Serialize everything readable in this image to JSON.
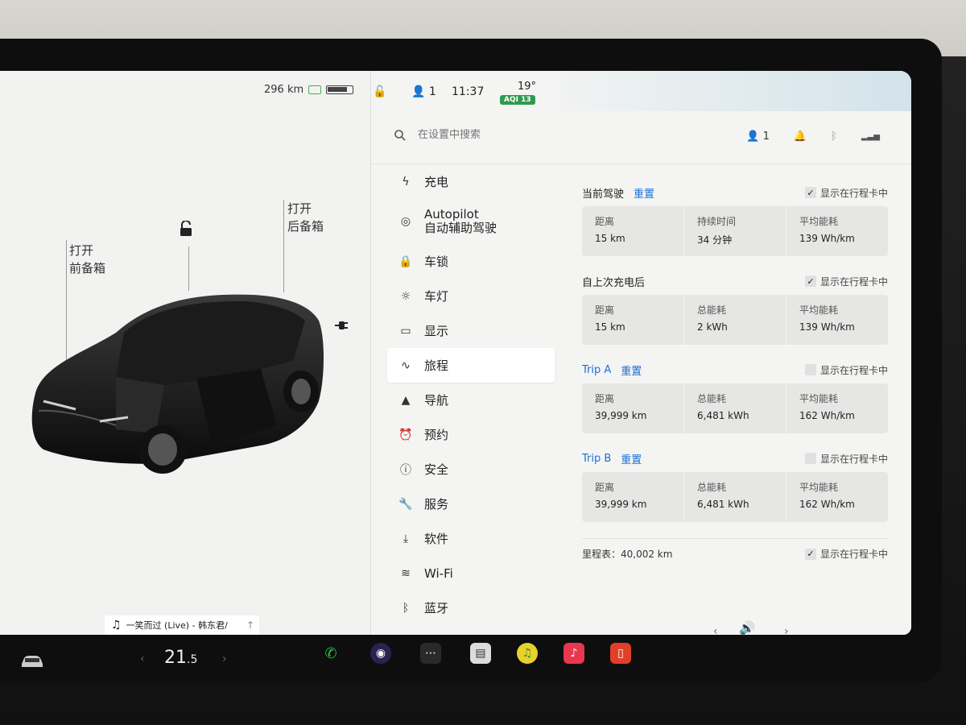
{
  "status": {
    "range": "296 km",
    "passengers": "1",
    "time": "11:37",
    "temperature": "19°",
    "aqi": "AQI 13"
  },
  "car_panel": {
    "frunk_label_line1": "打开",
    "frunk_label_line2": "前备箱",
    "trunk_label_line1": "打开",
    "trunk_label_line2": "后备箱"
  },
  "search": {
    "placeholder": "在设置中搜索",
    "profile_count": "1"
  },
  "nav": {
    "items": [
      {
        "label": "充电",
        "icon": "bolt-icon",
        "glyph": "ϟ"
      },
      {
        "label": "Autopilot",
        "label2": "自动辅助驾驶",
        "icon": "steering-wheel-icon",
        "glyph": "◎"
      },
      {
        "label": "车锁",
        "icon": "lock-icon",
        "glyph": "🔒"
      },
      {
        "label": "车灯",
        "icon": "light-icon",
        "glyph": "☼"
      },
      {
        "label": "显示",
        "icon": "display-icon",
        "glyph": "▭"
      },
      {
        "label": "旅程",
        "icon": "trip-icon",
        "glyph": "∿"
      },
      {
        "label": "导航",
        "icon": "navigation-icon",
        "glyph": "▲"
      },
      {
        "label": "预约",
        "icon": "alarm-icon",
        "glyph": "⏰"
      },
      {
        "label": "安全",
        "icon": "info-icon",
        "glyph": "ⓘ"
      },
      {
        "label": "服务",
        "icon": "wrench-icon",
        "glyph": "🔧"
      },
      {
        "label": "软件",
        "icon": "download-icon",
        "glyph": "⤓"
      },
      {
        "label": "Wi-Fi",
        "icon": "wifi-icon",
        "glyph": "≋"
      },
      {
        "label": "蓝牙",
        "icon": "bluetooth-icon",
        "glyph": "ᛒ"
      }
    ],
    "active_index": 5
  },
  "trips": {
    "current": {
      "title": "当前驾驶",
      "reset": "重置",
      "show_label": "显示在行程卡中",
      "checked": true,
      "stats": [
        {
          "label": "距离",
          "value": "15 km"
        },
        {
          "label": "持续时间",
          "value": "34 分钟"
        },
        {
          "label": "平均能耗",
          "value": "139 Wh/km"
        }
      ]
    },
    "since_charge": {
      "title": "自上次充电后",
      "show_label": "显示在行程卡中",
      "checked": true,
      "stats": [
        {
          "label": "距离",
          "value": "15 km"
        },
        {
          "label": "总能耗",
          "value": "2 kWh"
        },
        {
          "label": "平均能耗",
          "value": "139 Wh/km"
        }
      ]
    },
    "trip_a": {
      "title": "Trip A",
      "reset": "重置",
      "show_label": "显示在行程卡中",
      "checked": false,
      "stats": [
        {
          "label": "距离",
          "value": "39,999 km"
        },
        {
          "label": "总能耗",
          "value": "6,481 kWh"
        },
        {
          "label": "平均能耗",
          "value": "162 Wh/km"
        }
      ]
    },
    "trip_b": {
      "title": "Trip B",
      "reset": "重置",
      "show_label": "显示在行程卡中",
      "checked": false,
      "stats": [
        {
          "label": "距离",
          "value": "39,999 km"
        },
        {
          "label": "总能耗",
          "value": "6,481 kWh"
        },
        {
          "label": "平均能耗",
          "value": "162 Wh/km"
        }
      ]
    },
    "odometer": {
      "label": "里程表：40,002 km",
      "show_label": "显示在行程卡中",
      "checked": true
    }
  },
  "media": {
    "now_playing": "一笑而过 (Live) - 韩东君/"
  },
  "bottombar": {
    "temperature": "21",
    "temperature_decimal": ".5"
  },
  "colors": {
    "accent_blue": "#1a6fd8",
    "aqi_green": "#2e9b4f",
    "phone_green": "#2fbf4a",
    "music_red": "#e8384f"
  }
}
